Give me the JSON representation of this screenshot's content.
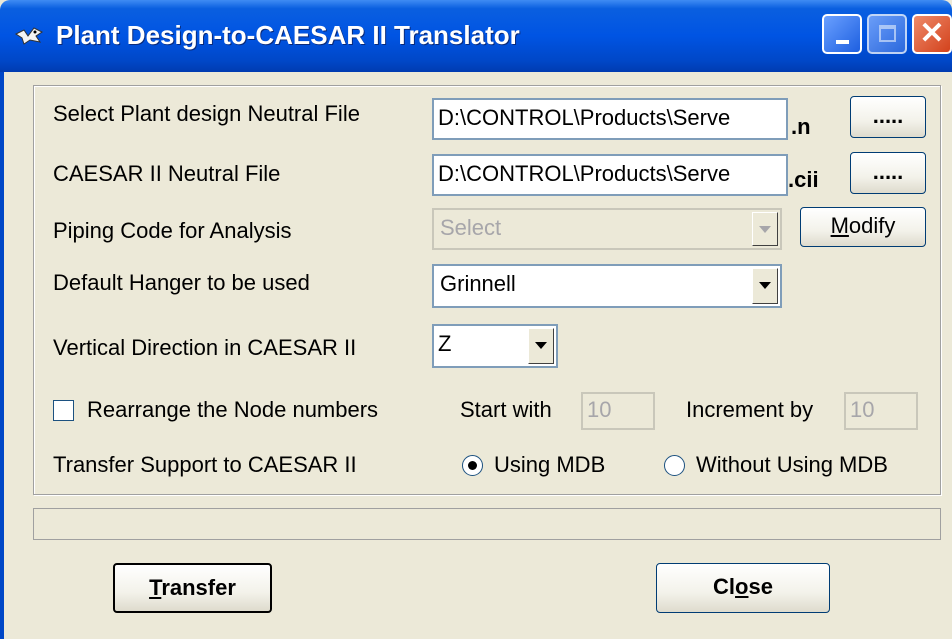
{
  "window": {
    "title": "Plant Design-to-CAESAR II Translator"
  },
  "form": {
    "neutral_file_label": "Select Plant design Neutral File",
    "neutral_file_value": "D:\\CONTROL\\Products\\Serve",
    "neutral_ext": ".n",
    "cii_label": "CAESAR II Neutral File",
    "cii_value": "D:\\CONTROL\\Products\\Serve",
    "cii_ext": ".cii",
    "browse_label": ".....",
    "piping_label": "Piping Code for Analysis",
    "piping_value": "Select",
    "modify_label_pre": "",
    "modify_label_u": "M",
    "modify_label_post": "odify",
    "hanger_label": "Default Hanger to be used",
    "hanger_value": "Grinnell",
    "vertical_label": "Vertical Direction in CAESAR II",
    "vertical_value": "Z",
    "rearrange_label": "Rearrange the Node numbers",
    "rearrange_checked": false,
    "start_label": "Start with",
    "start_value": "10",
    "increment_label": "Increment by",
    "increment_value": "10",
    "support_label": "Transfer Support to CAESAR II",
    "using_mdb_label": "Using MDB",
    "without_mdb_label": "Without Using MDB",
    "support_selected": "Using MDB"
  },
  "buttons": {
    "transfer_u": "T",
    "transfer_rest": "ransfer",
    "close_pre": "Cl",
    "close_u": "o",
    "close_post": "se"
  }
}
